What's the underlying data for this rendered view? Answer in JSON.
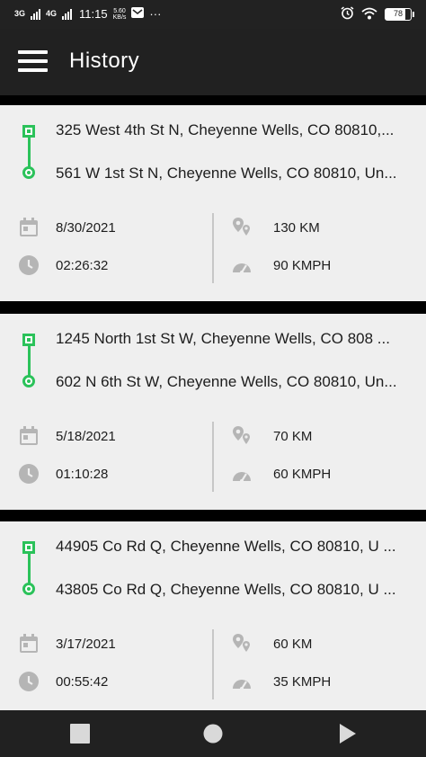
{
  "status_bar": {
    "network_1": "3G",
    "network_2": "4G",
    "time": "11:15",
    "speed_value": "5.60",
    "speed_unit": "KB/s",
    "more": "···",
    "battery": "78"
  },
  "app_bar": {
    "title": "History"
  },
  "trips": [
    {
      "from": "325 West 4th St N, Cheyenne Wells, CO 80810,...",
      "to": "561 W 1st St N, Cheyenne Wells, CO 80810, Un...",
      "date": "8/30/2021",
      "duration": "02:26:32",
      "distance": "130 KM",
      "speed": "90 KMPH"
    },
    {
      "from": "1245 North 1st St W, Cheyenne Wells, CO 808 ...",
      "to": "602 N 6th St W, Cheyenne Wells, CO 80810, Un...",
      "date": "5/18/2021",
      "duration": "01:10:28",
      "distance": "70 KM",
      "speed": "60 KMPH"
    },
    {
      "from": "44905 Co Rd Q, Cheyenne Wells, CO 80810, U ...",
      "to": "43805 Co Rd Q, Cheyenne Wells, CO 80810, U ...",
      "date": "3/17/2021",
      "duration": "00:55:42",
      "distance": "60 KM",
      "speed": "35 KMPH"
    }
  ],
  "colors": {
    "accent": "#2bc25a",
    "card_bg": "#efefef",
    "app_bar": "#212121",
    "icon_gray": "#b5b5b5"
  },
  "icons": {
    "menu": "hamburger-icon",
    "date": "calendar-icon",
    "duration": "clock-icon",
    "distance": "location-pins-icon",
    "speed": "speedometer-icon",
    "nav_recent": "square-icon",
    "nav_home": "circle-icon",
    "nav_back": "triangle-icon"
  }
}
